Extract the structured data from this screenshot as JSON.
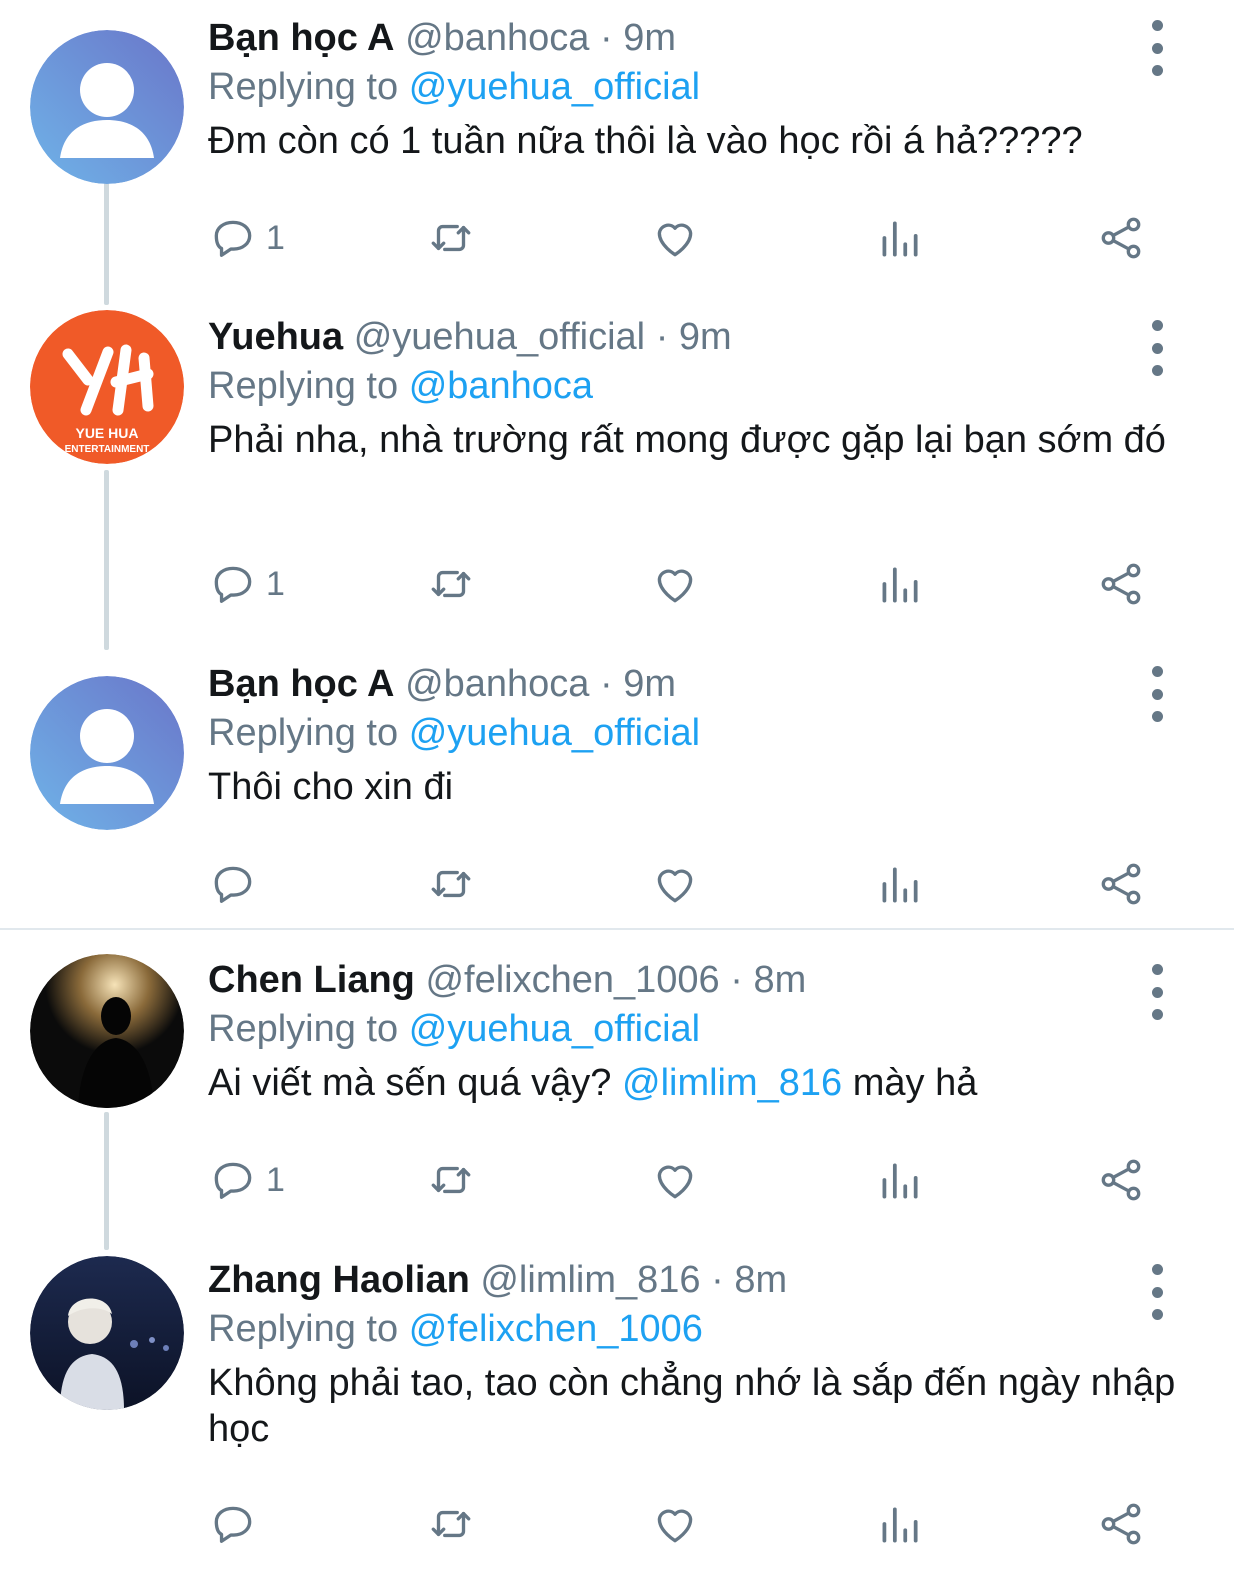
{
  "tweets": [
    {
      "name": "Bạn học A",
      "handle": "@banhoca",
      "time": "9m",
      "reply_prefix": "Replying to",
      "reply_to": "@yuehua_official",
      "text": "Đm còn có 1 tuần nữa thôi là vào học rồi á hả?????",
      "reply_count": "1",
      "avatar": "default-avatar-icon"
    },
    {
      "name": "Yuehua",
      "handle": "@yuehua_official",
      "time": "9m",
      "reply_prefix": "Replying to",
      "reply_to": "@banhoca",
      "text": "Phải nha, nhà trường rất mong được gặp lại bạn sớm đó",
      "reply_count": "1",
      "avatar": "yuehua-logo",
      "logo_text_1": "YUE HUA",
      "logo_text_2": "ENTERTAINMENT"
    },
    {
      "name": "Bạn học A",
      "handle": "@banhoca",
      "time": "9m",
      "reply_prefix": "Replying to",
      "reply_to": "@yuehua_official",
      "text": "Thôi cho xin đi",
      "reply_count": "",
      "avatar": "default-avatar-icon"
    },
    {
      "name": "Chen Liang",
      "handle": "@felixchen_1006",
      "time": "8m",
      "reply_prefix": "Replying to",
      "reply_to": "@yuehua_official",
      "text_before": "Ai viết mà sến quá vậy?",
      "text_mention": "@limlim_816",
      "text_after": "mày hả",
      "reply_count": "1",
      "avatar": "silhouette-photo"
    },
    {
      "name": "Zhang Haolian",
      "handle": "@limlim_816",
      "time": "8m",
      "reply_prefix": "Replying to",
      "reply_to": "@felixchen_1006",
      "text": "Không phải tao, tao còn chẳng nhớ là sắp đến ngày nhập học",
      "reply_count": "",
      "avatar": "night-photo"
    }
  ],
  "colors": {
    "text": "#14171a",
    "secondary": "#657786",
    "accent": "#1da1f2",
    "yuehua_orange": "#f05a28"
  }
}
